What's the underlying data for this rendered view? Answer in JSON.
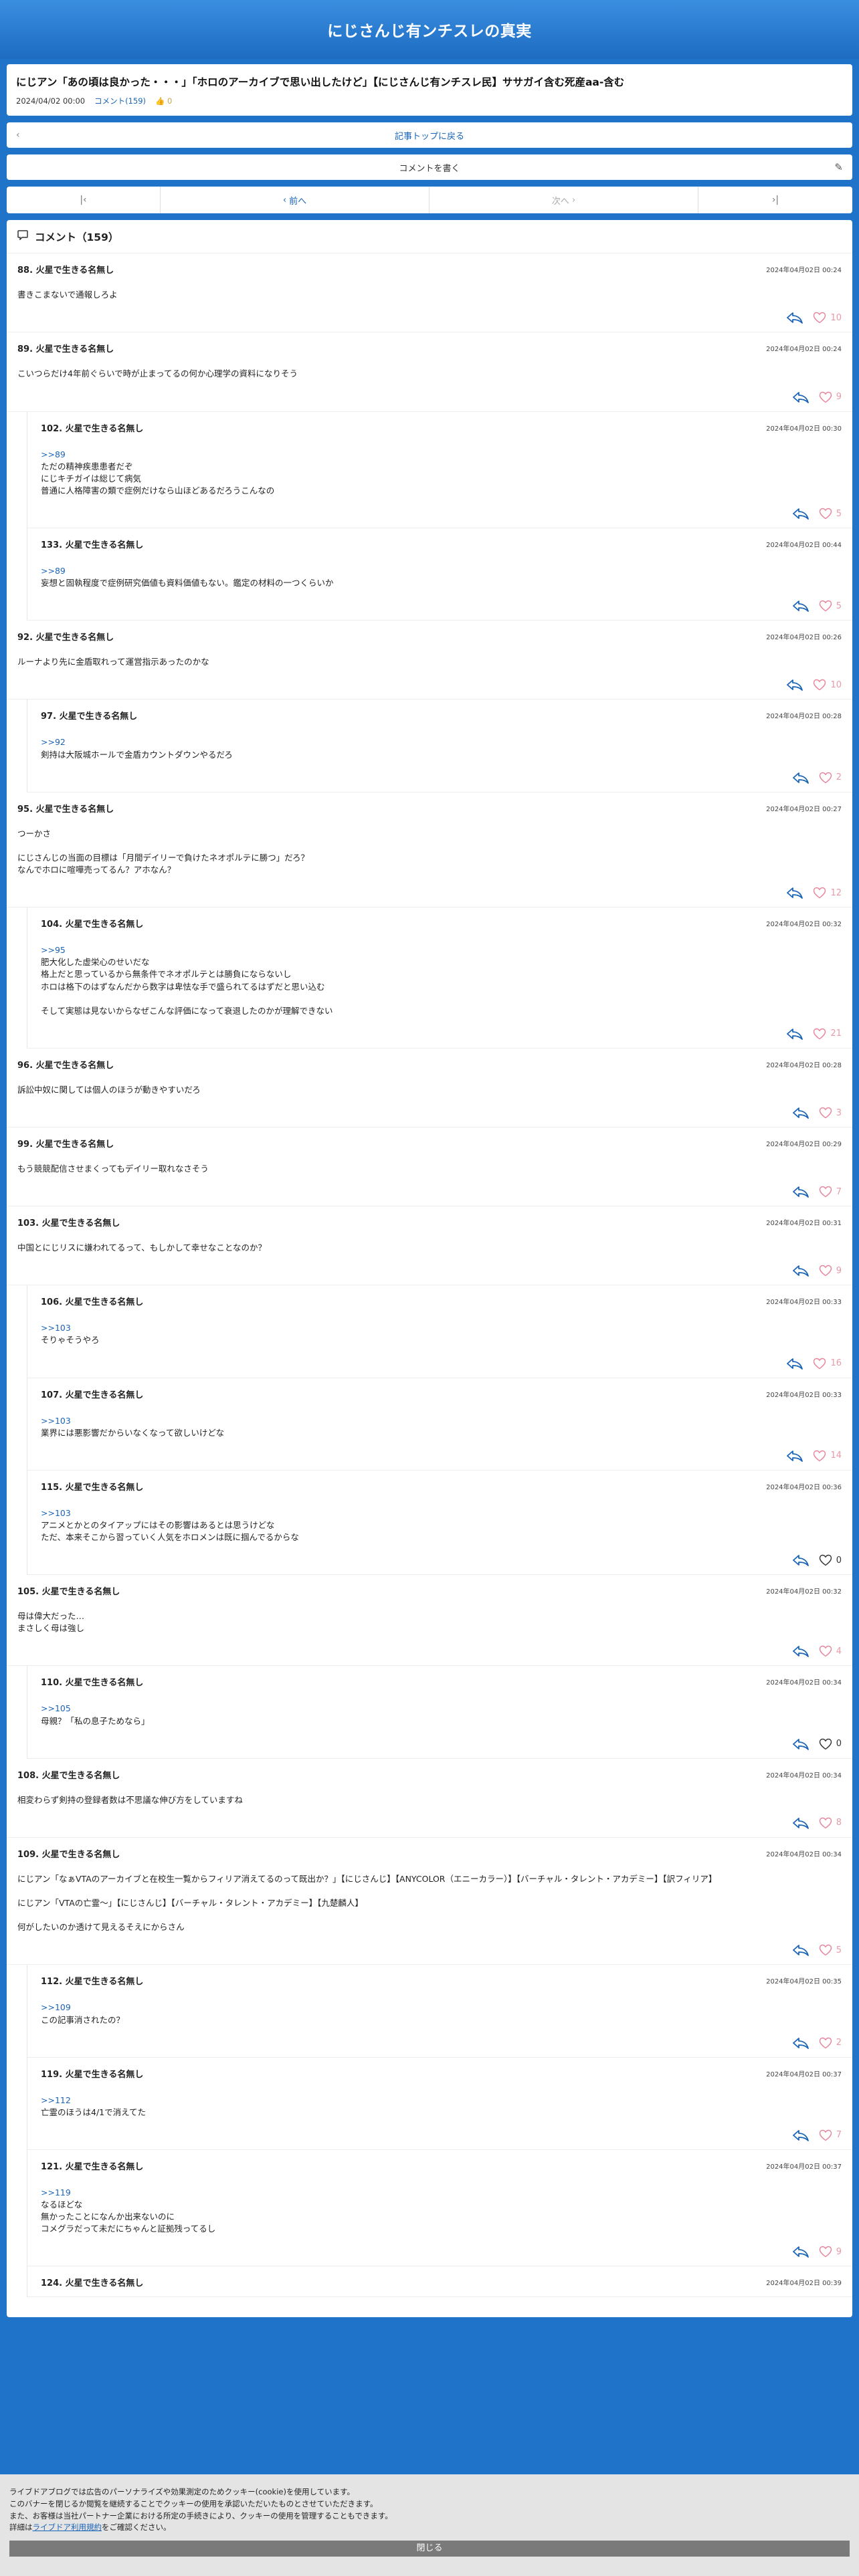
{
  "site": {
    "title": "にじさんじ有ンチスレの真実"
  },
  "article": {
    "title": "にじアン「あの頃は良かった・・・」「ホロのアーカイブで思い出したけど」【にじさんじ有ンチスレ民】ササガイ含む死産aa-含む",
    "date": "2024/04/02 00:00",
    "comments_link": "コメント(159)",
    "likes": "0"
  },
  "nav": {
    "back_label": "記事トップに戻る",
    "write_label": "コメントを書く",
    "prev_label": "前へ",
    "next_label": "次へ"
  },
  "comments_section": {
    "title": "コメント（159）"
  },
  "comments": [
    {
      "num": "88.",
      "name": "火星で生きる名無し",
      "date": "2024年04月02日 00:24",
      "anchor": "",
      "body": "書きこまないで通報しろよ",
      "likes": "10",
      "child": false
    },
    {
      "num": "89.",
      "name": "火星で生きる名無し",
      "date": "2024年04月02日 00:24",
      "anchor": "",
      "body": "こいつらだけ4年前ぐらいで時が止まってるの何か心理学の資料になりそう",
      "likes": "9",
      "child": false
    },
    {
      "num": "102.",
      "name": "火星で生きる名無し",
      "date": "2024年04月02日 00:30",
      "anchor": ">>89",
      "body": "ただの精神疾患患者だぞ\nにじキチガイは総じて病気\n普通に人格障害の類で症例だけなら山ほどあるだろうこんなの",
      "likes": "5",
      "child": true
    },
    {
      "num": "133.",
      "name": "火星で生きる名無し",
      "date": "2024年04月02日 00:44",
      "anchor": ">>89",
      "body": "妄想と固執程度で症例研究価値も資料価値もない。鑑定の材料の一つくらいか",
      "likes": "5",
      "child": true
    },
    {
      "num": "92.",
      "name": "火星で生きる名無し",
      "date": "2024年04月02日 00:26",
      "anchor": "",
      "body": "ルーナより先に金盾取れって運営指示あったのかな",
      "likes": "10",
      "child": false
    },
    {
      "num": "97.",
      "name": "火星で生きる名無し",
      "date": "2024年04月02日 00:28",
      "anchor": ">>92",
      "body": "剣持は大阪城ホールで金盾カウントダウンやるだろ",
      "likes": "2",
      "child": true
    },
    {
      "num": "95.",
      "name": "火星で生きる名無し",
      "date": "2024年04月02日 00:27",
      "anchor": "",
      "body": "つーかさ\n\nにじさんじの当面の目標は「月間デイリーで負けたネオポルテに勝つ」だろ？\nなんでホロに喧嘩売ってるん？アホなん？",
      "likes": "12",
      "child": false
    },
    {
      "num": "104.",
      "name": "火星で生きる名無し",
      "date": "2024年04月02日 00:32",
      "anchor": ">>95",
      "body": "肥大化した虚栄心のせいだな\n格上だと思っているから無条件でネオポルテとは勝負にならないし\nホロは格下のはずなんだから数字は卑怯な手で盛られてるはずだと思い込む\n\nそして実態は見ないからなぜこんな評価になって衰退したのかが理解できない",
      "likes": "21",
      "child": true
    },
    {
      "num": "96.",
      "name": "火星で生きる名無し",
      "date": "2024年04月02日 00:28",
      "anchor": "",
      "body": "訴訟中奴に関しては個人のほうが動きやすいだろ",
      "likes": "3",
      "child": false
    },
    {
      "num": "99.",
      "name": "火星で生きる名無し",
      "date": "2024年04月02日 00:29",
      "anchor": "",
      "body": "もう競競配信させまくってもデイリー取れなさそう",
      "likes": "7",
      "child": false
    },
    {
      "num": "103.",
      "name": "火星で生きる名無し",
      "date": "2024年04月02日 00:31",
      "anchor": "",
      "body": "中国とにじリスに嫌われてるって、もしかして幸せなことなのか？",
      "likes": "9",
      "child": false
    },
    {
      "num": "106.",
      "name": "火星で生きる名無し",
      "date": "2024年04月02日 00:33",
      "anchor": ">>103",
      "body": "そりゃそうやろ",
      "likes": "16",
      "child": true
    },
    {
      "num": "107.",
      "name": "火星で生きる名無し",
      "date": "2024年04月02日 00:33",
      "anchor": ">>103",
      "body": "業界には悪影響だからいなくなって欲しいけどな",
      "likes": "14",
      "child": true
    },
    {
      "num": "115.",
      "name": "火星で生きる名無し",
      "date": "2024年04月02日 00:36",
      "anchor": ">>103",
      "body": "アニメとかとのタイアップにはその影響はあるとは思うけどな\nただ、本来そこから習っていく人気をホロメンは既に掴んでるからな",
      "likes": "0",
      "child": true
    },
    {
      "num": "105.",
      "name": "火星で生きる名無し",
      "date": "2024年04月02日 00:32",
      "anchor": "",
      "body": "母は偉大だった…\nまさしく母は強し",
      "likes": "4",
      "child": false
    },
    {
      "num": "110.",
      "name": "火星で生きる名無し",
      "date": "2024年04月02日 00:34",
      "anchor": ">>105",
      "body": "母親？「私の息子ためなら」",
      "likes": "0",
      "child": true
    },
    {
      "num": "108.",
      "name": "火星で生きる名無し",
      "date": "2024年04月02日 00:34",
      "anchor": "",
      "body": "相変わらず剣持の登録者数は不思議な伸び方をしていますね",
      "likes": "8",
      "child": false
    },
    {
      "num": "109.",
      "name": "火星で生きる名無し",
      "date": "2024年04月02日 00:34",
      "anchor": "",
      "body": "にじアン「なぁVTAのアーカイブと在校生一覧からフィリア消えてるのって既出か？」【にじさんじ】【ANYCOLOR（エニーカラー）】【バーチャル・タレント・アカデミー】【訳フィリア】\n\nにじアン「VTAの亡霊〜」【にじさんじ】【バーチャル・タレント・アカデミー】【九楚麟人】\n\n何がしたいのか透けて見えるそえにからさん",
      "likes": "5",
      "child": false
    },
    {
      "num": "112.",
      "name": "火星で生きる名無し",
      "date": "2024年04月02日 00:35",
      "anchor": ">>109",
      "body": "この記事消されたの？",
      "likes": "2",
      "child": true
    },
    {
      "num": "119.",
      "name": "火星で生きる名無し",
      "date": "2024年04月02日 00:37",
      "anchor": ">>112",
      "body": "亡霊のほうは4/1で消えてた",
      "likes": "7",
      "child": true
    },
    {
      "num": "121.",
      "name": "火星で生きる名無し",
      "date": "2024年04月02日 00:37",
      "anchor": ">>119",
      "body": "なるほどな\n無かったことになんか出来ないのに\nコメグラだって未だにちゃんと証拠残ってるし",
      "likes": "9",
      "child": true
    },
    {
      "num": "124.",
      "name": "火星で生きる名無し",
      "date": "2024年04月02日 00:39",
      "anchor": "",
      "body": "",
      "likes": "",
      "child": true
    }
  ],
  "cookie": {
    "line1": "ライブドアブログでは広告のパーソナライズや効果測定のためクッキー(cookie)を使用しています。",
    "line2": "このバナーを閉じるか閲覧を継続することでクッキーの使用を承認いただいたものとさせていただきます。",
    "line3": "また、お客様は当社パートナー企業における所定の手続きにより、クッキーの使用を管理することもできます。",
    "line4_prefix": "詳細は",
    "line4_link": "ライブドア利用規約",
    "line4_suffix": "をご確認ください。",
    "close_label": "閉じる"
  }
}
